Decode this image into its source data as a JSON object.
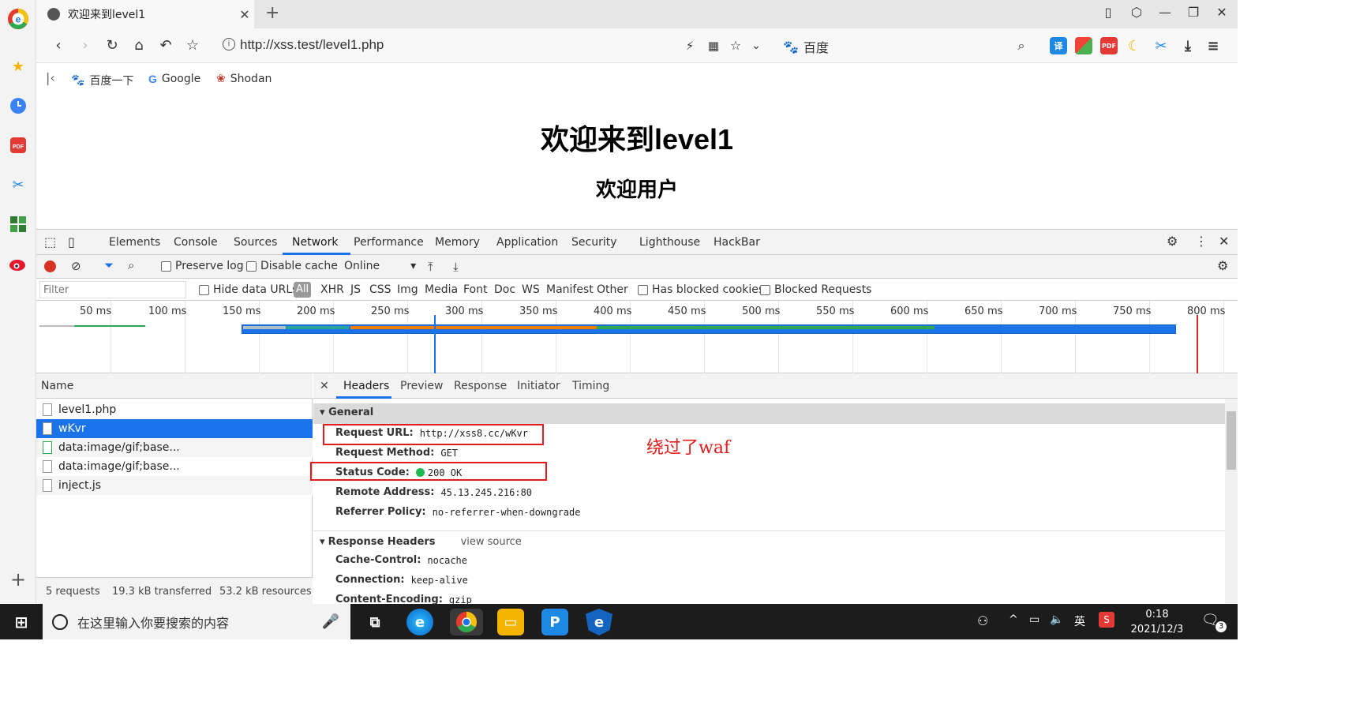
{
  "browser": {
    "tab_title": "欢迎来到level1",
    "tab_close": "✕",
    "new_tab": "+",
    "url": "http://xss.test/level1.php",
    "search_engine": "百度",
    "window_controls": [
      "restore-down-icon",
      "minimize-icon",
      "maximize-icon",
      "close-icon"
    ]
  },
  "bookmarks": [
    {
      "label": "百度一下",
      "icon": "baidu-icon"
    },
    {
      "label": "Google",
      "icon": "google-icon"
    },
    {
      "label": "Shodan",
      "icon": "shodan-icon"
    }
  ],
  "page": {
    "heading": "欢迎来到level1",
    "subheading": "欢迎用户"
  },
  "devtools": {
    "tabs": [
      "Elements",
      "Console",
      "Sources",
      "Network",
      "Performance",
      "Memory",
      "Application",
      "Security",
      "Lighthouse",
      "HackBar"
    ],
    "active_tab": "Network",
    "controls": {
      "preserve_log": "Preserve log",
      "disable_cache": "Disable cache",
      "throttle": "Online"
    },
    "filter": {
      "placeholder": "Filter",
      "hide_data_urls": "Hide data URLs",
      "types": [
        "All",
        "XHR",
        "JS",
        "CSS",
        "Img",
        "Media",
        "Font",
        "Doc",
        "WS",
        "Manifest",
        "Other"
      ],
      "has_blocked_cookies": "Has blocked cookies",
      "blocked_requests": "Blocked Requests"
    },
    "timeline_labels": [
      "50 ms",
      "100 ms",
      "150 ms",
      "200 ms",
      "250 ms",
      "300 ms",
      "350 ms",
      "400 ms",
      "450 ms",
      "500 ms",
      "550 ms",
      "600 ms",
      "650 ms",
      "700 ms",
      "750 ms",
      "800 ms"
    ],
    "request_list": {
      "header": "Name",
      "rows": [
        "level1.php",
        "wKvr",
        "data:image/gif;base...",
        "data:image/gif;base...",
        "inject.js"
      ],
      "selected": "wKvr",
      "summary": {
        "requests": "5 requests",
        "transferred": "19.3 kB transferred",
        "resources": "53.2 kB resources"
      }
    },
    "detail": {
      "close": "✕",
      "tabs": [
        "Headers",
        "Preview",
        "Response",
        "Initiator",
        "Timing"
      ],
      "active_tab": "Headers",
      "general_title": "General",
      "general": [
        {
          "key": "Request URL:",
          "value": "http://xss8.cc/wKvr"
        },
        {
          "key": "Request Method:",
          "value": "GET"
        },
        {
          "key": "Status Code:",
          "value": "200 OK"
        },
        {
          "key": "Remote Address:",
          "value": "45.13.245.216:80"
        },
        {
          "key": "Referrer Policy:",
          "value": "no-referrer-when-downgrade"
        }
      ],
      "response_headers_title": "Response Headers",
      "view_source": "view source",
      "response_headers": [
        {
          "key": "Cache-Control:",
          "value": "nocache"
        },
        {
          "key": "Connection:",
          "value": "keep-alive"
        },
        {
          "key": "Content-Encoding:",
          "value": "gzip"
        }
      ],
      "annotation": "绕过了waf"
    }
  },
  "taskbar": {
    "search_placeholder": "在这里输入你要搜索的内容",
    "ime": "英",
    "time": "0:18",
    "date": "2021/12/3",
    "notification_count": "3"
  },
  "colors": {
    "accent": "#1a73e8",
    "annotation_red": "#e21b1b",
    "status_green": "#1db954"
  }
}
